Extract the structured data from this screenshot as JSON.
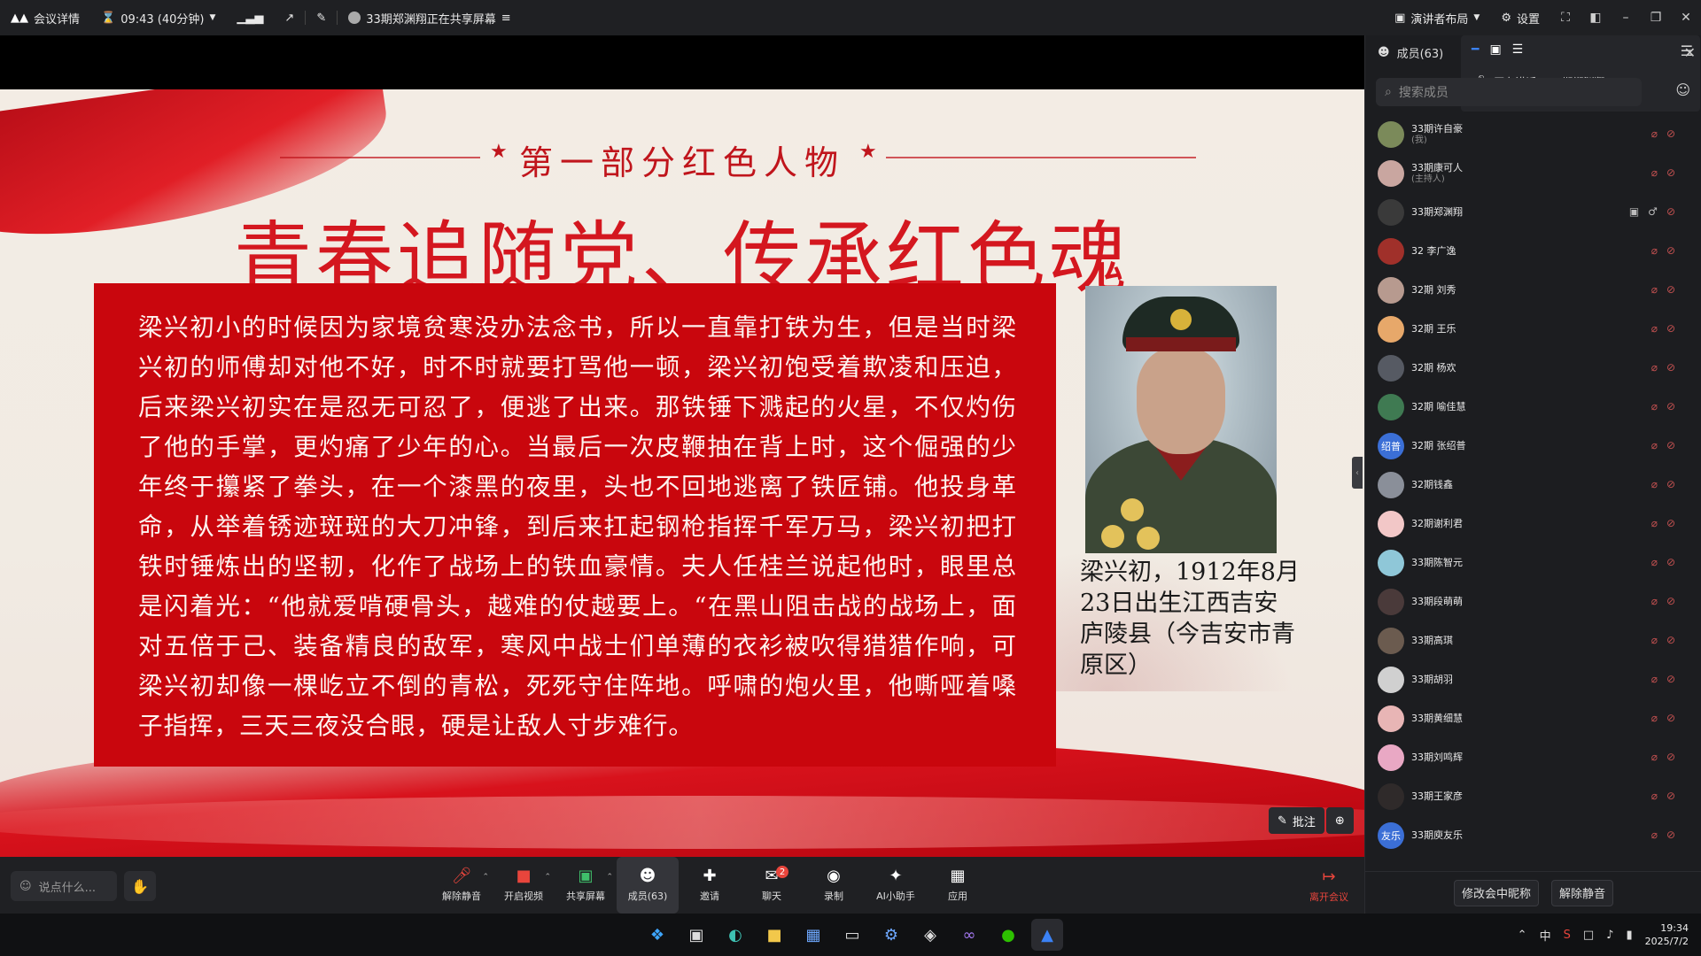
{
  "topbar": {
    "meeting_details": "会议详情",
    "timer": "09:43 (40分钟)",
    "sharing": "33期郑渊翔正在共享屏幕",
    "presenter_layout": "演讲者布局",
    "settings": "设置"
  },
  "slide": {
    "part_heading": "第一部分红色人物",
    "main_title": "青春追随党、传承红色魂",
    "body": "梁兴初小的时候因为家境贫寒没办法念书，所以一直靠打铁为生，但是当时梁兴初的师傅却对他不好，时不时就要打骂他一顿，梁兴初饱受着欺凌和压迫，后来梁兴初实在是忍无可忍了，便逃了出来。那铁锤下溅起的火星，不仅灼伤了他的手掌，更灼痛了少年的心。当最后一次皮鞭抽在背上时，这个倔强的少年终于攥紧了拳头，在一个漆黑的夜里，头也不回地逃离了铁匠铺。他投身革命，从举着锈迹斑斑的大刀冲锋，到后来扛起钢枪指挥千军万马，梁兴初把打铁时锤炼出的坚韧，化作了战场上的铁血豪情。夫人任桂兰说起他时，眼里总是闪着光：“他就爱啃硬骨头，越难的仗越要上。“在黑山阻击战的战场上，面对五倍于己、装备精良的敌军，寒风中战士们单薄的衣衫被吹得猎猎作响，可梁兴初却像一棵屹立不倒的青松，死死守住阵地。呼啸的炮火里，他嘶哑着嗓子指挥，三天三夜没合眼，硬是让敌人寸步难行。",
    "caption": "梁兴初，1912年8月23日出生江西吉安庐陵县（今吉安市青原区）"
  },
  "annotate": {
    "label": "批注"
  },
  "toolbar": {
    "say_placeholder": "说点什么...",
    "unmute": "解除静音",
    "video": "开启视频",
    "share": "共享屏幕",
    "members": "成员(63)",
    "invite": "邀请",
    "chat": "聊天",
    "chat_badge": "2",
    "record": "录制",
    "ai": "AI小助手",
    "apps": "应用",
    "leave": "离开会议"
  },
  "panel": {
    "title": "成员(63)",
    "speaking_label": "正在讲话:",
    "speaking_name": "33期郑渊翔;",
    "search_placeholder": "搜索成员",
    "members": [
      {
        "name": "33期许自豪",
        "role": "(我)",
        "color": "#7b8a5a"
      },
      {
        "name": "33期康可人",
        "role": "(主持人)",
        "color": "#c9a6a0"
      },
      {
        "name": "33期郑渊翔",
        "role": "",
        "color": "#3a3a3a"
      },
      {
        "name": "32 李广逸",
        "role": "",
        "color": "#a0302a"
      },
      {
        "name": "32期 刘秀",
        "role": "",
        "color": "#b79a8f"
      },
      {
        "name": "32期 王乐",
        "role": "",
        "color": "#e7a86a"
      },
      {
        "name": "32期 杨欢",
        "role": "",
        "color": "#565a63"
      },
      {
        "name": "32期 喻佳慧",
        "role": "",
        "color": "#3f7a52"
      },
      {
        "name": "32期 张绍普",
        "role": "",
        "color": "#3b6fd6"
      },
      {
        "name": "32期钱鑫",
        "role": "",
        "color": "#8a8f99"
      },
      {
        "name": "32期谢利君",
        "role": "",
        "color": "#f2c7c7"
      },
      {
        "name": "33期陈智元",
        "role": "",
        "color": "#8fc7d8"
      },
      {
        "name": "33期段萌萌",
        "role": "",
        "color": "#4a3a3a"
      },
      {
        "name": "33期高琪",
        "role": "",
        "color": "#6b5b4f"
      },
      {
        "name": "33期胡羽",
        "role": "",
        "color": "#d0d0d0"
      },
      {
        "name": "33期黄细慧",
        "role": "",
        "color": "#e8b5b5"
      },
      {
        "name": "33期刘鸣辉",
        "role": "",
        "color": "#e9a8c4"
      },
      {
        "name": "33期王家彦",
        "role": "",
        "color": "#2f2a2a"
      },
      {
        "name": "33期庾友乐",
        "role": "",
        "color": "#3b6fd6"
      }
    ],
    "avatar_text": {
      "zhang": "绍普",
      "yu": "友乐"
    },
    "rename_button": "修改会中昵称",
    "unmute_button": "解除静音"
  },
  "taskbar": {
    "ime": "中",
    "time": "19:34",
    "date": "2025/7/2"
  },
  "colors": {
    "slide_red": "#c9060d",
    "title_red": "#d4171f",
    "leave_red": "#e8453c",
    "muted_icon": "#c25050"
  }
}
